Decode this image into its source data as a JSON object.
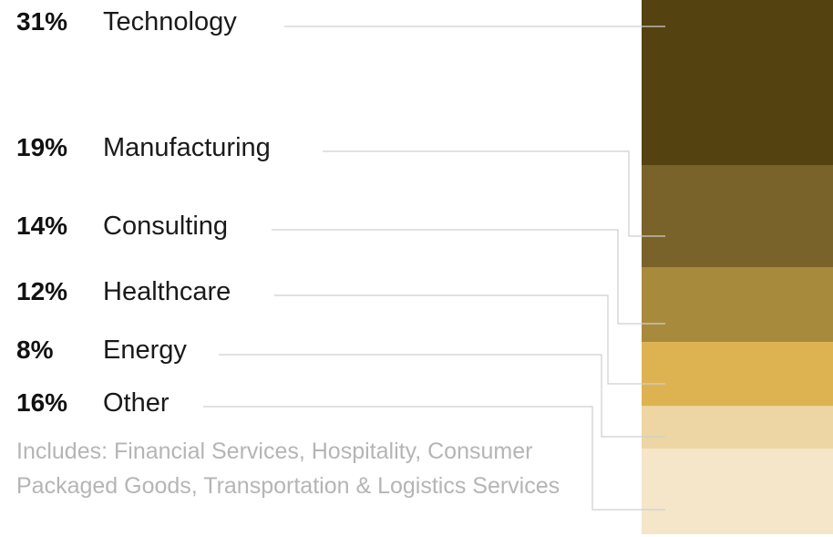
{
  "chart_data": {
    "type": "bar",
    "stacked": true,
    "orientation": "vertical",
    "categories": [
      "Technology",
      "Manufacturing",
      "Consulting",
      "Healthcare",
      "Energy",
      "Other"
    ],
    "labels": [
      "31%",
      "19%",
      "14%",
      "12%",
      "8%",
      "16%"
    ],
    "values": [
      31,
      19,
      14,
      12,
      8,
      16
    ],
    "colors": [
      "#554211",
      "#7a632a",
      "#a88a3d",
      "#ddb352",
      "#edd6a3",
      "#f5e6c9"
    ],
    "note": "Includes: Financial Services, Hospitality, Consumer Packaged Goods, Transportation & Logistics Services",
    "legend": "left"
  }
}
